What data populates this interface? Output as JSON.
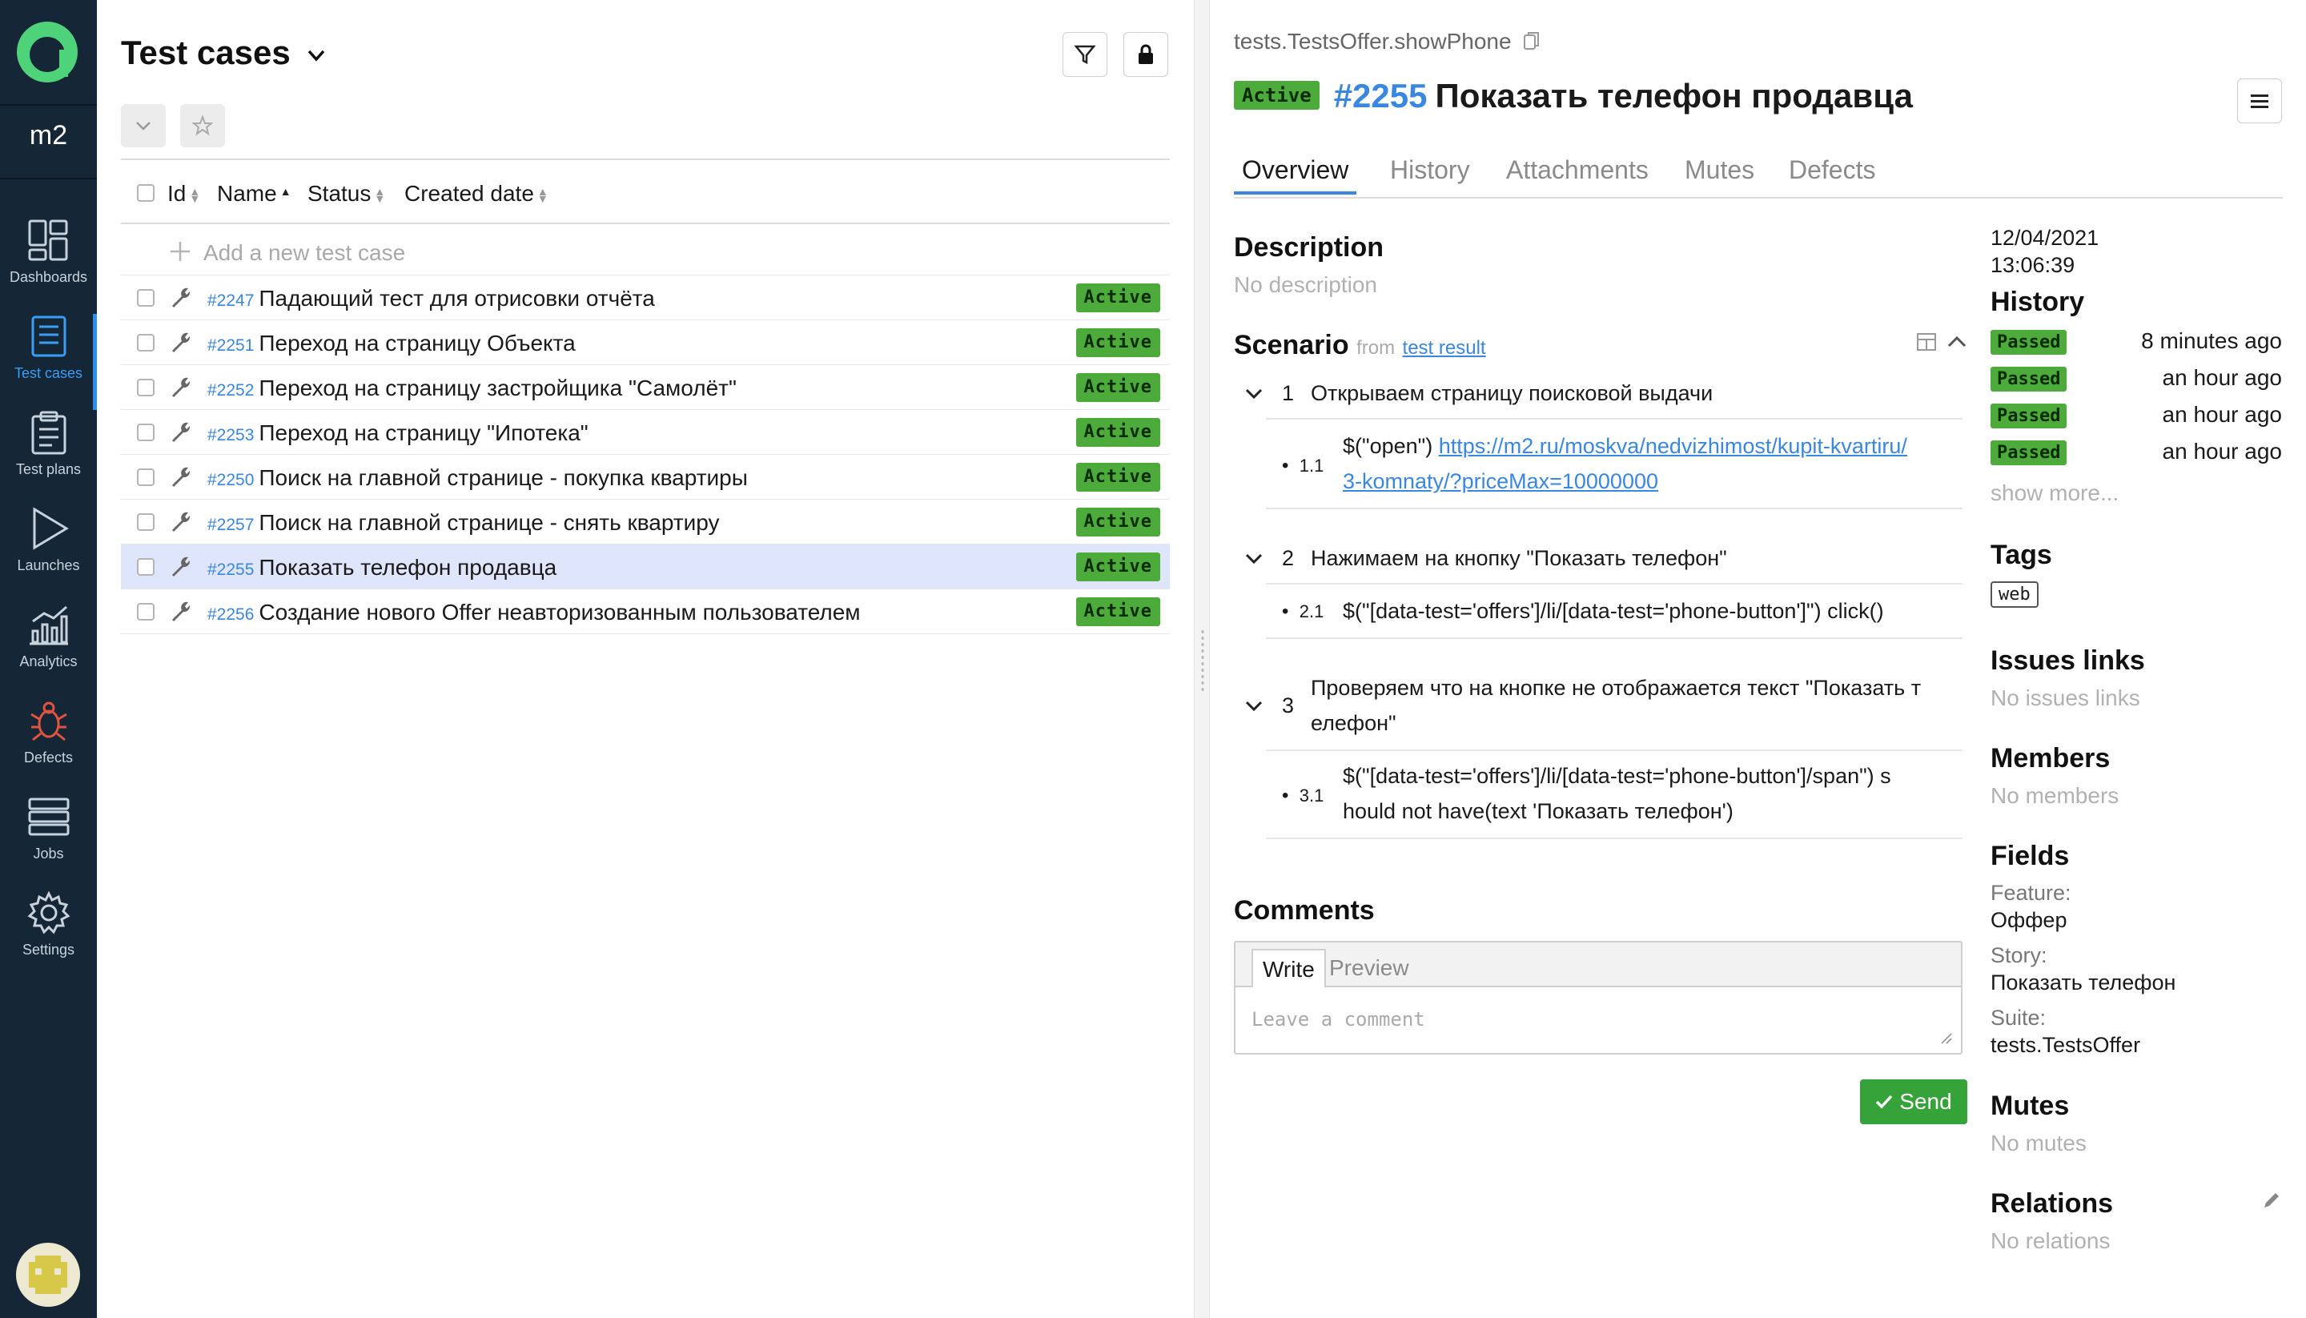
{
  "sidebar": {
    "project": "m2",
    "items": [
      {
        "label": "Dashboards",
        "icon": "dashboards-icon"
      },
      {
        "label": "Test cases",
        "icon": "test-cases-icon"
      },
      {
        "label": "Test plans",
        "icon": "test-plans-icon"
      },
      {
        "label": "Launches",
        "icon": "launches-icon"
      },
      {
        "label": "Analytics",
        "icon": "analytics-icon"
      },
      {
        "label": "Defects",
        "icon": "defects-icon"
      },
      {
        "label": "Jobs",
        "icon": "jobs-icon"
      },
      {
        "label": "Settings",
        "icon": "settings-icon"
      }
    ],
    "active_item": "Test cases"
  },
  "list": {
    "title": "Test cases",
    "columns": {
      "id": "Id",
      "name": "Name",
      "status": "Status",
      "created": "Created date"
    },
    "add_placeholder": "Add a new test case",
    "rows": [
      {
        "id": "#2247",
        "name": "Падающий тест для отрисовки отчёта",
        "status": "Active",
        "selected": false
      },
      {
        "id": "#2251",
        "name": "Переход на страницу Объекта",
        "status": "Active",
        "selected": false
      },
      {
        "id": "#2252",
        "name": "Переход на страницу застройщика \"Самолёт\"",
        "status": "Active",
        "selected": false
      },
      {
        "id": "#2253",
        "name": "Переход на страницу \"Ипотека\"",
        "status": "Active",
        "selected": false
      },
      {
        "id": "#2250",
        "name": "Поиск на главной странице - покупка квартиры",
        "status": "Active",
        "selected": false
      },
      {
        "id": "#2257",
        "name": "Поиск на главной странице - снять квартиру",
        "status": "Active",
        "selected": false
      },
      {
        "id": "#2255",
        "name": "Показать телефон продавца",
        "status": "Active",
        "selected": true
      },
      {
        "id": "#2256",
        "name": "Создание нового Offer неавторизованным пользователем",
        "status": "Active",
        "selected": false
      }
    ]
  },
  "detail": {
    "path": "tests.TestsOffer.showPhone",
    "status": "Active",
    "id": "#2255",
    "title": "Показать телефон продавца",
    "tabs": [
      "Overview",
      "History",
      "Attachments",
      "Mutes",
      "Defects"
    ],
    "active_tab": "Overview",
    "description": {
      "heading": "Description",
      "text": "No description"
    },
    "scenario": {
      "heading": "Scenario",
      "from_label": "from",
      "from_link": "test result",
      "steps": [
        {
          "num": "1",
          "text": "Открываем страницу поисковой выдачи",
          "sub": {
            "num": "1.1",
            "prefix": "$(\"open\") ",
            "link_line1": "https://m2.ru/moskva/nedvizhimost/kupit-kvartiru/",
            "link_line2": "3-komnaty/?priceMax=10000000"
          }
        },
        {
          "num": "2",
          "text": "Нажимаем на кнопку \"Показать телефон\"",
          "sub": {
            "num": "2.1",
            "text": "$(\"[data-test='offers']/li/[data-test='phone-button']\") click()"
          }
        },
        {
          "num": "3",
          "text_line1": "Проверяем что на кнопке не отображается текст \"Показать т",
          "text_line2": "елефон\"",
          "sub": {
            "num": "3.1",
            "text_line1": "$(\"[data-test='offers']/li/[data-test='phone-button']/span\") s",
            "text_line2": "hould not have(text 'Показать телефон')"
          }
        }
      ]
    },
    "comments": {
      "heading": "Comments",
      "tab_write": "Write",
      "tab_preview": "Preview",
      "placeholder": "Leave a comment",
      "send": "Send"
    },
    "meta": {
      "date": "12/04/2021",
      "time": "13:06:39",
      "history_heading": "History",
      "history": [
        {
          "status": "Passed",
          "when": "8 minutes ago"
        },
        {
          "status": "Passed",
          "when": "an hour ago"
        },
        {
          "status": "Passed",
          "when": "an hour ago"
        },
        {
          "status": "Passed",
          "when": "an hour ago"
        }
      ],
      "show_more": "show more...",
      "tags_heading": "Tags",
      "tags": [
        "web"
      ],
      "issues_heading": "Issues links",
      "issues_empty": "No issues links",
      "members_heading": "Members",
      "members_empty": "No members",
      "fields_heading": "Fields",
      "fields": [
        {
          "key": "Feature:",
          "value": "Оффер"
        },
        {
          "key": "Story:",
          "value": "Показать телефон"
        },
        {
          "key": "Suite:",
          "value": "tests.TestsOffer"
        }
      ],
      "mutes_heading": "Mutes",
      "mutes_empty": "No mutes",
      "relations_heading": "Relations",
      "relations_empty": "No relations"
    }
  },
  "colors": {
    "sidebar": "#152636",
    "accent": "#3a87e0",
    "badge": "#4cab3a",
    "selected_row": "#dfe6fb",
    "logo": "#4fd37a"
  }
}
